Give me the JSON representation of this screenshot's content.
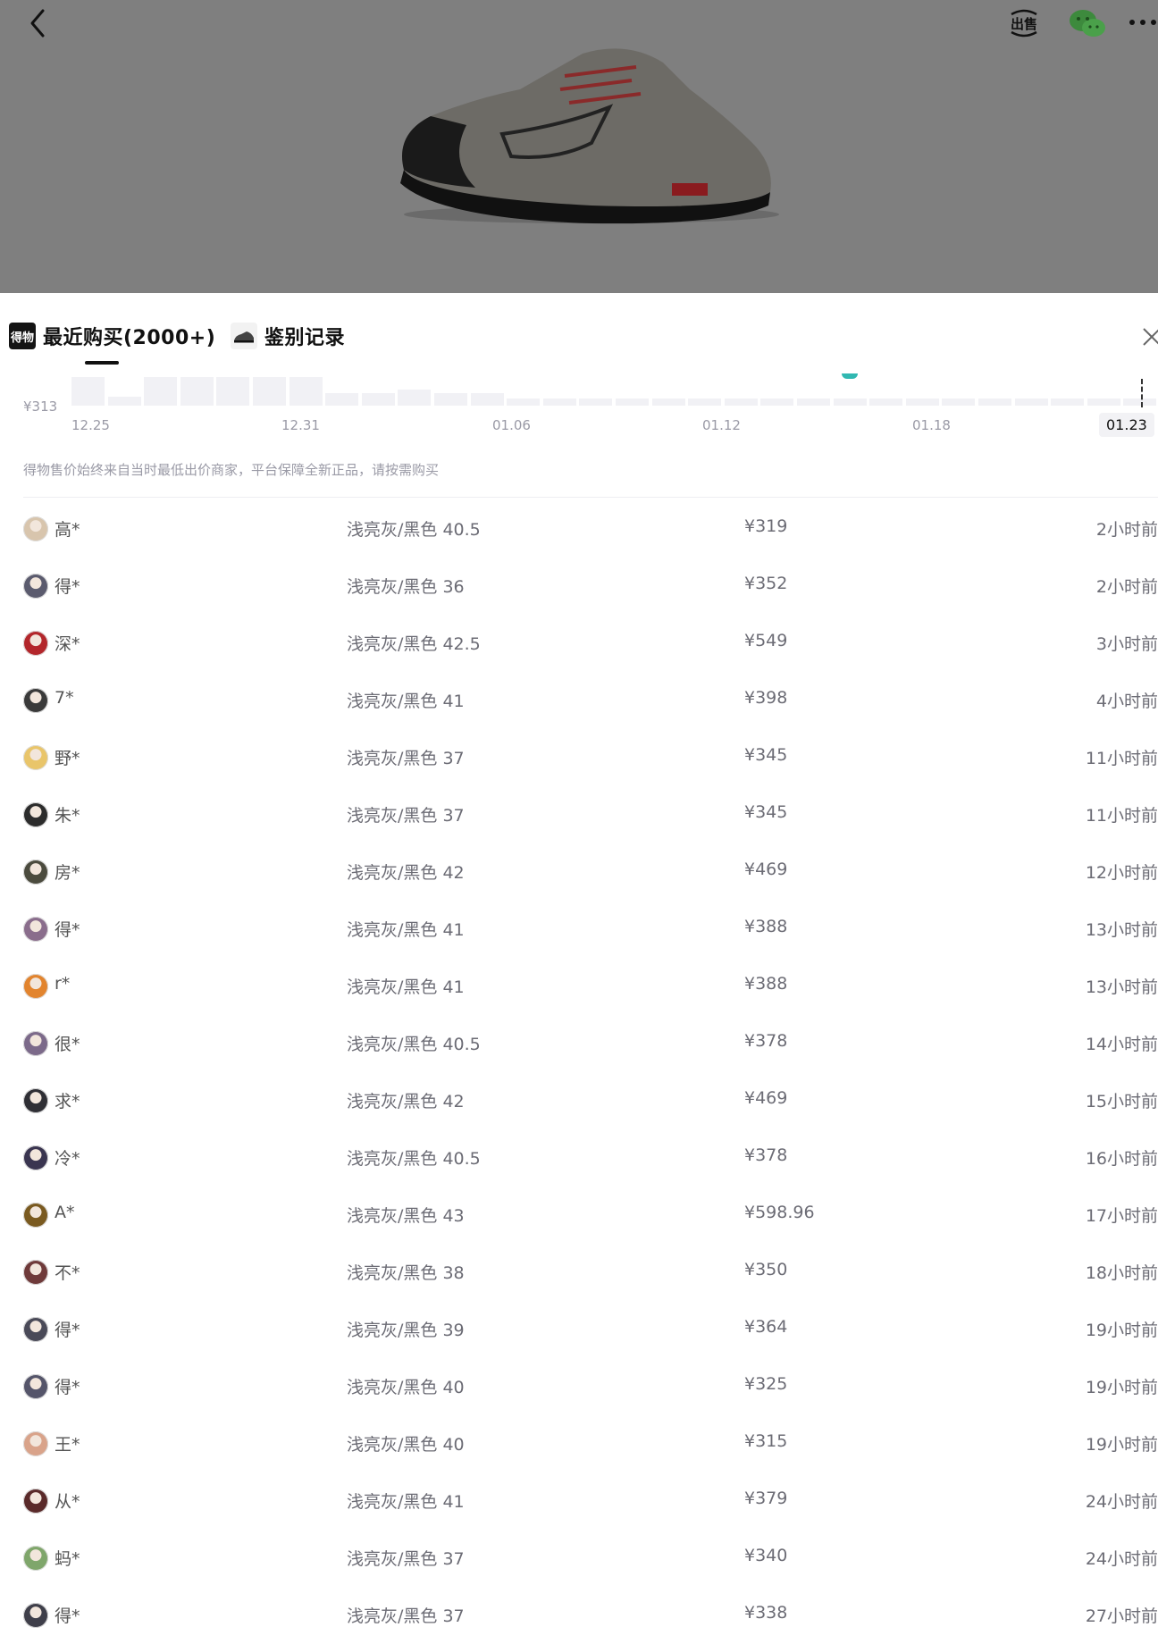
{
  "header": {
    "icons": [
      "back-icon",
      "sell-icon",
      "wechat-icon",
      "more-icon"
    ],
    "sell_label": "出售"
  },
  "sheet": {
    "tabs": [
      {
        "label": "最近购买(2000+)",
        "active": true,
        "icon": "dewu-logo-icon"
      },
      {
        "label": "鉴别记录",
        "active": false,
        "icon": "shoe-thumbnail-icon"
      }
    ],
    "logo_text": "得物",
    "close_icon": "close-icon"
  },
  "chart_data": {
    "type": "bar",
    "y_ticks": [
      "¥313"
    ],
    "x_ticks": [
      "12.25",
      "12.31",
      "01.06",
      "01.12",
      "01.18",
      "01.23"
    ],
    "selected_x": "01.23",
    "colors": {
      "bar": "#f1f1f5",
      "marker": "#31b8b1",
      "guide": "#333333"
    }
  },
  "disclaimer": "得物售价始终来自当时最低出价商家，平台保障全新正品，请按需购买",
  "rows": [
    {
      "name": "高*",
      "variant": "浅亮灰/黑色 40.5",
      "price": "¥319",
      "time": "2小时前",
      "avatar_color": "#d8c5ad"
    },
    {
      "name": "得*",
      "variant": "浅亮灰/黑色 36",
      "price": "¥352",
      "time": "2小时前",
      "avatar_color": "#5b5b6e"
    },
    {
      "name": "深*",
      "variant": "浅亮灰/黑色 42.5",
      "price": "¥549",
      "time": "3小时前",
      "avatar_color": "#b3262b"
    },
    {
      "name": "7*",
      "variant": "浅亮灰/黑色 41",
      "price": "¥398",
      "time": "4小时前",
      "avatar_color": "#3a3a3a"
    },
    {
      "name": "野*",
      "variant": "浅亮灰/黑色 37",
      "price": "¥345",
      "time": "11小时前",
      "avatar_color": "#e9c56a"
    },
    {
      "name": "朱*",
      "variant": "浅亮灰/黑色 37",
      "price": "¥345",
      "time": "11小时前",
      "avatar_color": "#2c2c2c"
    },
    {
      "name": "房*",
      "variant": "浅亮灰/黑色 42",
      "price": "¥469",
      "time": "12小时前",
      "avatar_color": "#4b4b3e"
    },
    {
      "name": "得*",
      "variant": "浅亮灰/黑色 41",
      "price": "¥388",
      "time": "13小时前",
      "avatar_color": "#8a6d8c"
    },
    {
      "name": "r*",
      "variant": "浅亮灰/黑色 41",
      "price": "¥388",
      "time": "13小时前",
      "avatar_color": "#e2842e"
    },
    {
      "name": "很*",
      "variant": "浅亮灰/黑色 40.5",
      "price": "¥378",
      "time": "14小时前",
      "avatar_color": "#7c6a8a"
    },
    {
      "name": "求*",
      "variant": "浅亮灰/黑色 42",
      "price": "¥469",
      "time": "15小时前",
      "avatar_color": "#2f2f35"
    },
    {
      "name": "冷*",
      "variant": "浅亮灰/黑色 40.5",
      "price": "¥378",
      "time": "16小时前",
      "avatar_color": "#3a3550"
    },
    {
      "name": "A*",
      "variant": "浅亮灰/黑色 43",
      "price": "¥598.96",
      "time": "17小时前",
      "avatar_color": "#7a5a20"
    },
    {
      "name": "不*",
      "variant": "浅亮灰/黑色 38",
      "price": "¥350",
      "time": "18小时前",
      "avatar_color": "#6f3a3a"
    },
    {
      "name": "得*",
      "variant": "浅亮灰/黑色 39",
      "price": "¥364",
      "time": "19小时前",
      "avatar_color": "#4a4a58"
    },
    {
      "name": "得*",
      "variant": "浅亮灰/黑色 40",
      "price": "¥325",
      "time": "19小时前",
      "avatar_color": "#55556a"
    },
    {
      "name": "王*",
      "variant": "浅亮灰/黑色 40",
      "price": "¥315",
      "time": "19小时前",
      "avatar_color": "#d9a38a"
    },
    {
      "name": "从*",
      "variant": "浅亮灰/黑色 41",
      "price": "¥379",
      "time": "24小时前",
      "avatar_color": "#5a2a2a"
    },
    {
      "name": "蚂*",
      "variant": "浅亮灰/黑色 37",
      "price": "¥340",
      "time": "24小时前",
      "avatar_color": "#7fa66b"
    },
    {
      "name": "得*",
      "variant": "浅亮灰/黑色 37",
      "price": "¥338",
      "time": "27小时前",
      "avatar_color": "#3f3f4a"
    }
  ]
}
